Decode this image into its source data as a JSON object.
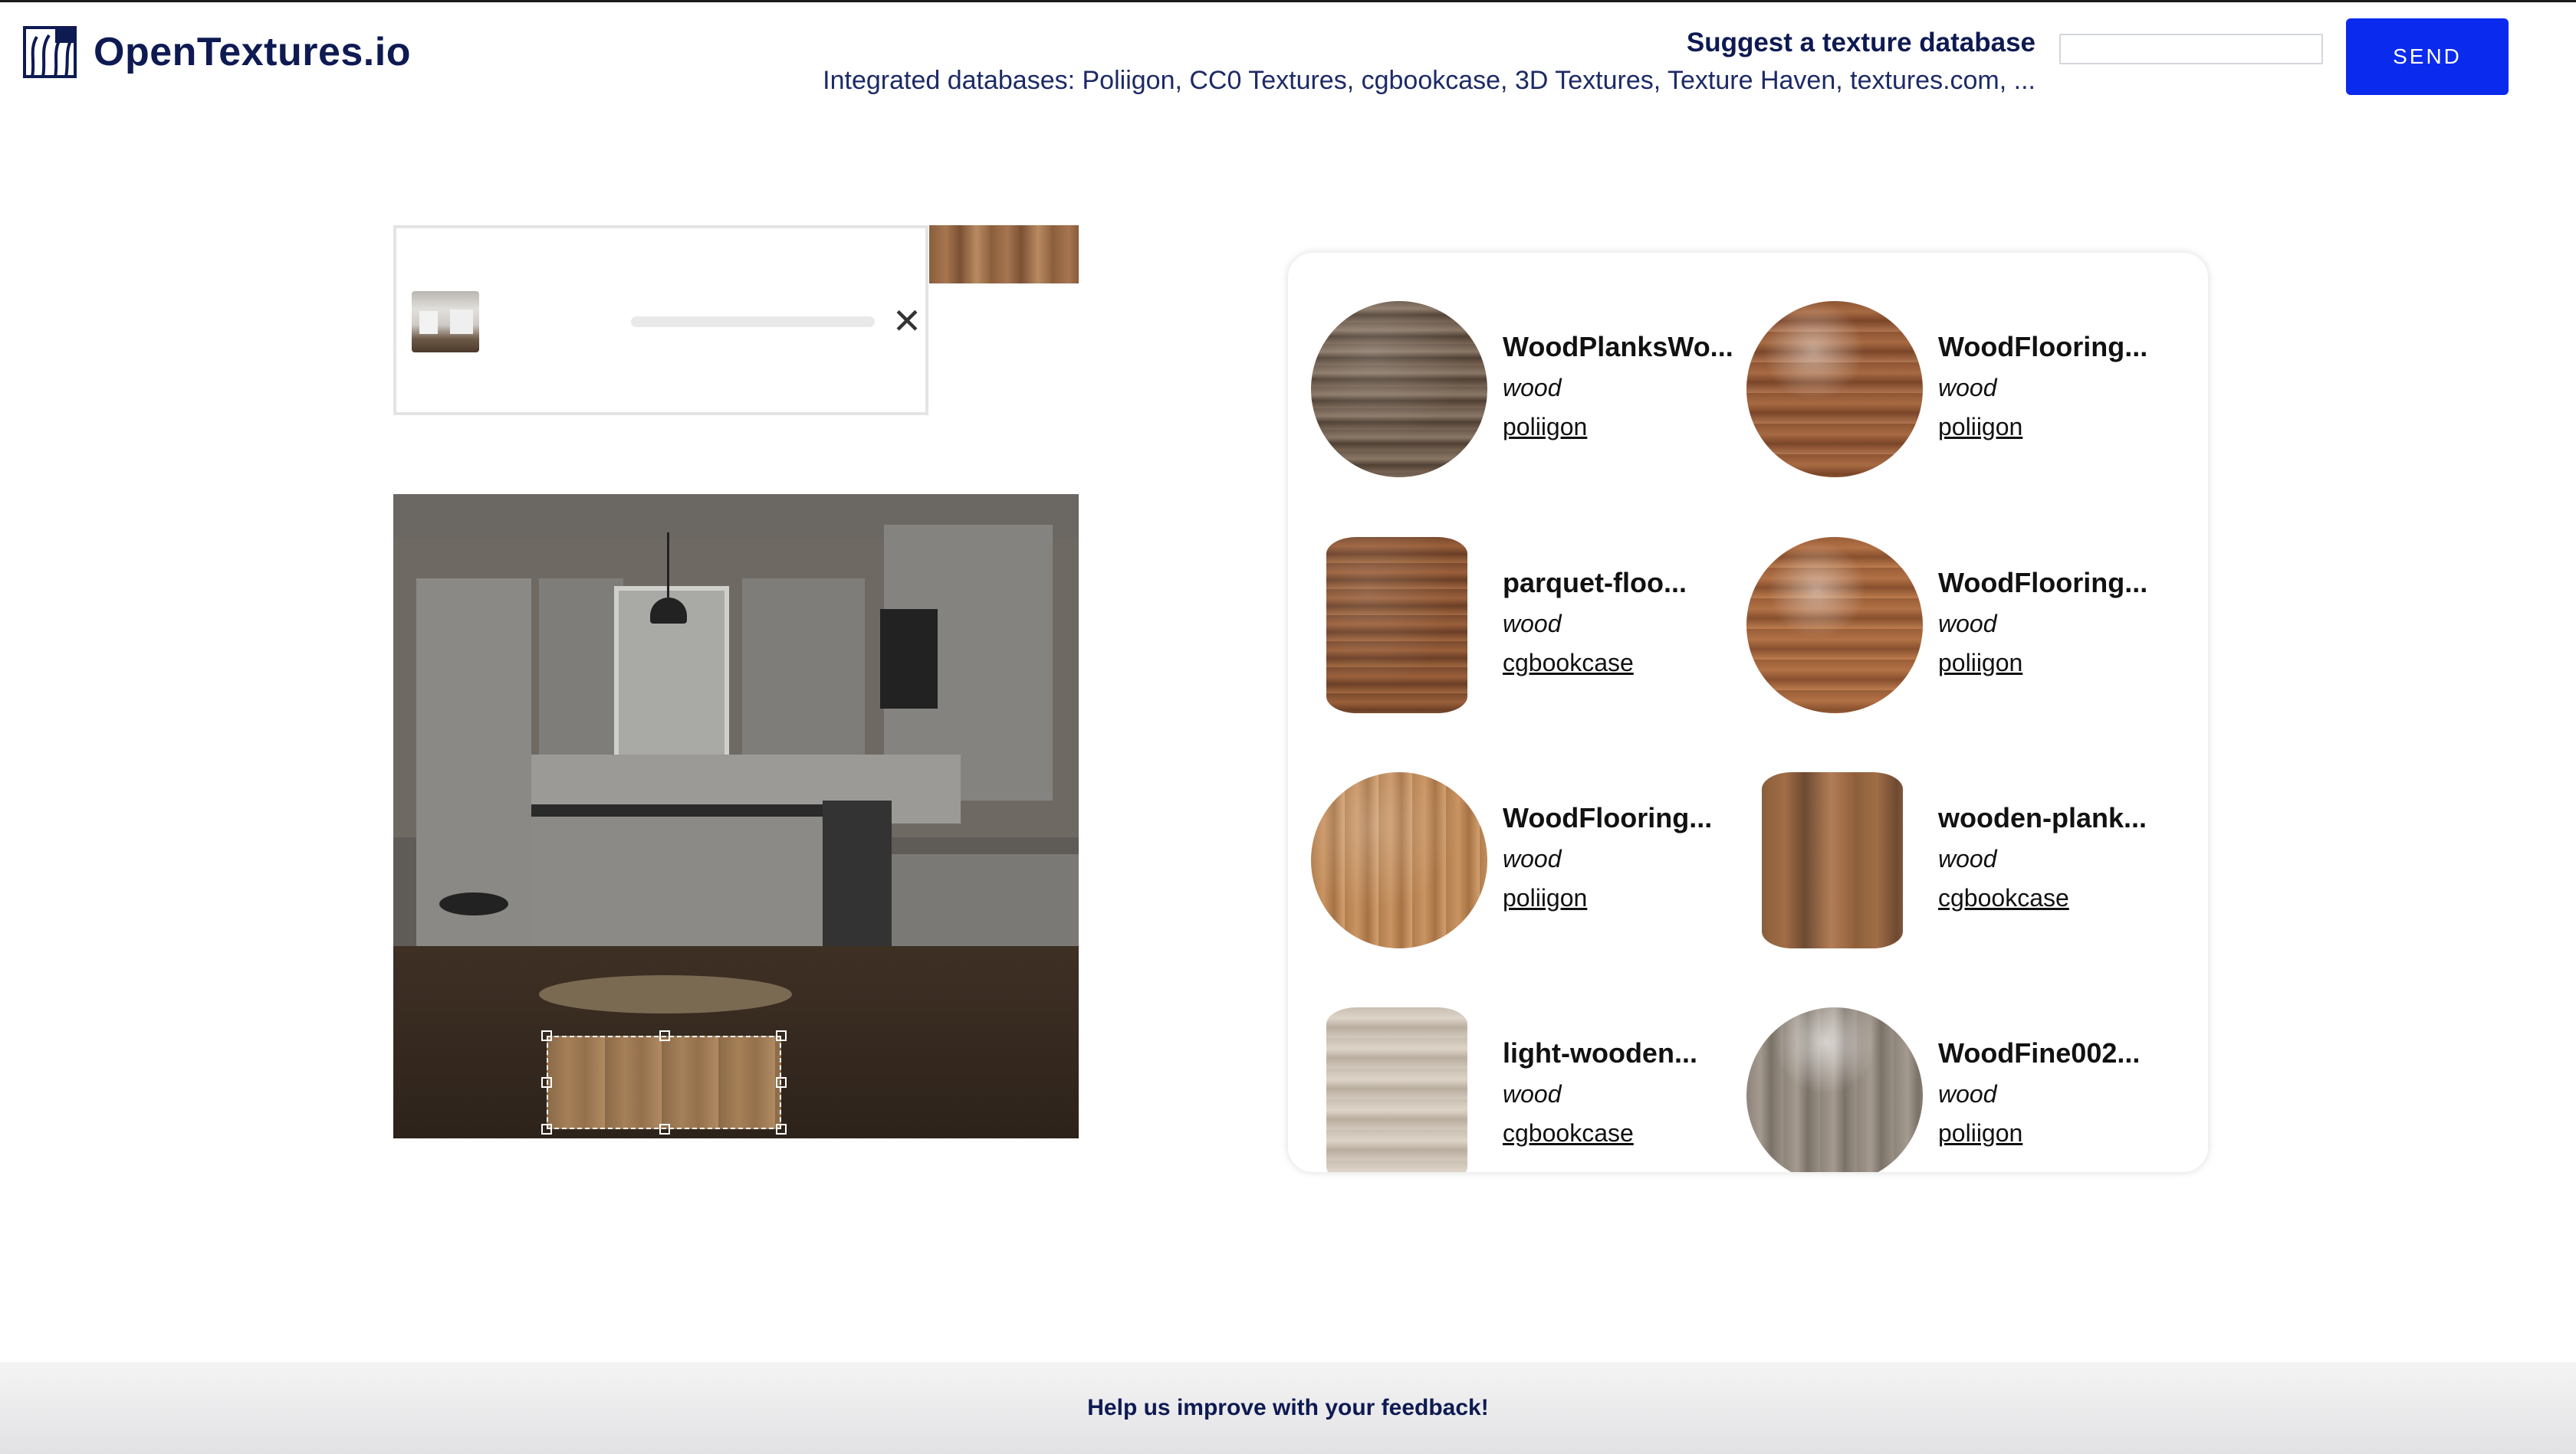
{
  "app": {
    "title": "OpenTextures.io",
    "logo_icon": "wood-grain-logo-icon"
  },
  "header": {
    "suggest_label": "Suggest a texture database",
    "suggest_input_value": "",
    "send_label": "SEND",
    "integrated_text": "Integrated databases: Poliigon, CC0 Textures, cgbookcase, 3D Textures, Texture Haven, textures.com, ..."
  },
  "upload": {
    "thumbnail_icon": "kitchen-thumbnail",
    "close_icon": "close-icon",
    "close_symbol": "✕"
  },
  "results": [
    {
      "name": "WoodPlanksWo...",
      "category": "wood",
      "source": "poliigon"
    },
    {
      "name": "WoodFlooring...",
      "category": "wood",
      "source": "poliigon"
    },
    {
      "name": "parquet-floo...",
      "category": "wood",
      "source": "cgbookcase"
    },
    {
      "name": "WoodFlooring...",
      "category": "wood",
      "source": "poliigon"
    },
    {
      "name": "WoodFlooring...",
      "category": "wood",
      "source": "poliigon"
    },
    {
      "name": "wooden-plank...",
      "category": "wood",
      "source": "cgbookcase"
    },
    {
      "name": "light-wooden...",
      "category": "wood",
      "source": "cgbookcase"
    },
    {
      "name": "WoodFine002...",
      "category": "wood",
      "source": "poliigon"
    }
  ],
  "footer": {
    "feedback_text": "Help us improve with your feedback!"
  },
  "colors": {
    "accent": "#0a2aee",
    "brand_text": "#0e1a52"
  }
}
